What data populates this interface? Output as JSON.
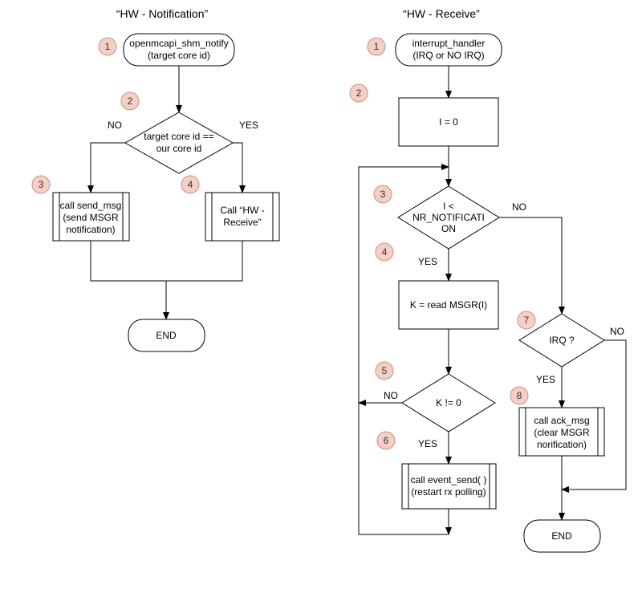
{
  "titles": {
    "left": "“HW - Notification”",
    "right": "“HW - Receive”"
  },
  "left": {
    "badges": {
      "n1": "1",
      "n2": "2",
      "n3": "3",
      "n4": "4"
    },
    "start_line1": "openmcapi_shm_notify",
    "start_line2": "(target core id)",
    "decision_line1": "target core id ==",
    "decision_line2": "our core id",
    "decision_yes": "YES",
    "decision_no": "NO",
    "proc_a_line1": "call send_msg",
    "proc_a_line2": "(send MSGR",
    "proc_a_line3": "notification)",
    "proc_b_line1": "Call “HW -",
    "proc_b_line2": "Receive”",
    "end": "END"
  },
  "right": {
    "badges": {
      "n1": "1",
      "n2": "2",
      "n3": "3",
      "n4": "4",
      "n5": "5",
      "n6": "6",
      "n7": "7",
      "n8": "8"
    },
    "start_line1": "interrupt_handler",
    "start_line2": "(IRQ or NO IRQ)",
    "init": "I  = 0",
    "loop_line1": "I <",
    "loop_line2": "NR_NOTIFICATI",
    "loop_line3": "ON",
    "loop_yes": "YES",
    "loop_no": "NO",
    "read": "K = read MSGR(I)",
    "knz": "K != 0",
    "knz_yes": "YES",
    "knz_no": "NO",
    "event_line1": "call event_send(   )",
    "event_line2": "(restart rx polling)",
    "irq": "IRQ ?",
    "irq_yes": "YES",
    "irq_no": "NO",
    "ack_line1": "call ack_msg",
    "ack_line2": "(clear MSGR",
    "ack_line3": "norification)",
    "end": "END"
  }
}
